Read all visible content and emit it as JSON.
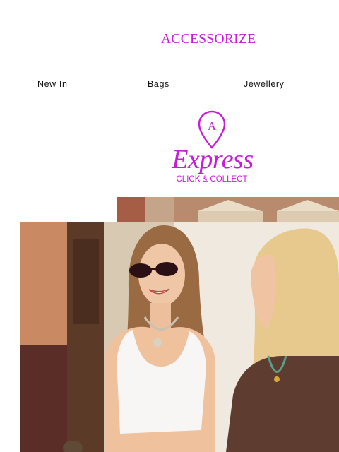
{
  "brand": {
    "logo_text": "ACCESSORIZE",
    "accent_color": "#c41fd4"
  },
  "nav": {
    "items": [
      {
        "label": "New In"
      },
      {
        "label": "Bags"
      },
      {
        "label": "Jewellery"
      }
    ]
  },
  "express_banner": {
    "icon": "location-pin-icon",
    "pin_letter": "A",
    "title": "Express",
    "subtitle": "CLICK & COLLECT"
  },
  "hero": {
    "image": "two-women-street-photo"
  }
}
